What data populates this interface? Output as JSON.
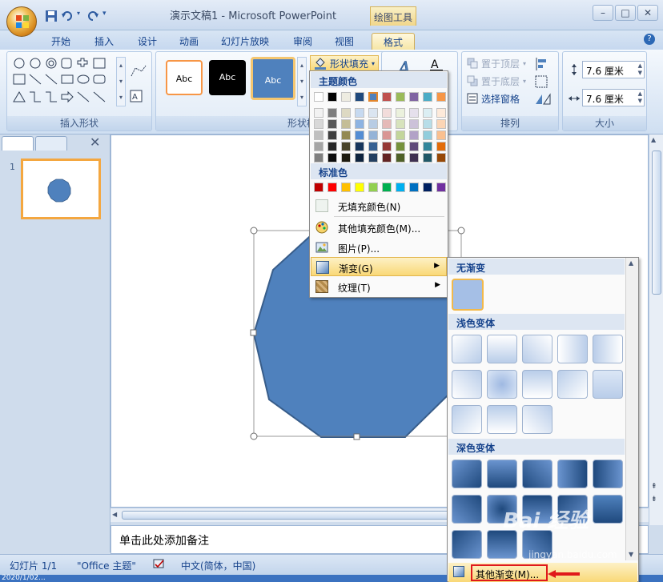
{
  "titlebar": {
    "doc_title": "演示文稿1 - Microsoft PowerPoint",
    "context_tab_title": "绘图工具",
    "minimize": "–",
    "maximize": "□",
    "close": "✕"
  },
  "tabs": [
    {
      "label": "开始"
    },
    {
      "label": "插入"
    },
    {
      "label": "设计"
    },
    {
      "label": "动画"
    },
    {
      "label": "幻灯片放映"
    },
    {
      "label": "审阅"
    },
    {
      "label": "视图"
    },
    {
      "label": "格式"
    }
  ],
  "ribbon": {
    "insert_shapes": {
      "label": "插入形状"
    },
    "shape_styles": {
      "label": "形状样式",
      "swatch_text": "Abc",
      "fill_button": "形状填充"
    },
    "arrange": {
      "label": "排列",
      "bring_front": "置于顶层",
      "send_back": "置于底层",
      "selection_pane": "选择窗格"
    },
    "size": {
      "label": "大小",
      "height": "7.6 厘米",
      "width": "7.6 厘米"
    }
  },
  "fill_menu": {
    "theme_colors_header": "主题颜色",
    "standard_colors_header": "标准色",
    "theme_top_row": [
      "#ffffff",
      "#000000",
      "#eeece1",
      "#1f497d",
      "#4f81bd",
      "#c0504d",
      "#9bbb59",
      "#8064a2",
      "#4bacc6",
      "#f79646"
    ],
    "theme_shades": [
      [
        "#f2f2f2",
        "#7f7f7f",
        "#ddd9c3",
        "#c6d9f0",
        "#dbe5f1",
        "#f2dcdb",
        "#ebf1dd",
        "#e5e0ec",
        "#dbeef3",
        "#fdeada"
      ],
      [
        "#d8d8d8",
        "#595959",
        "#c4bd97",
        "#8db3e2",
        "#b8cce4",
        "#e5b9b7",
        "#d7e3bc",
        "#ccc1d9",
        "#b7dde8",
        "#fbd5b5"
      ],
      [
        "#bfbfbf",
        "#3f3f3f",
        "#938953",
        "#548dd4",
        "#95b3d7",
        "#d99694",
        "#c3d69b",
        "#b2a2c7",
        "#92cddc",
        "#fac08f"
      ],
      [
        "#a5a5a5",
        "#262626",
        "#494429",
        "#17365d",
        "#366092",
        "#953734",
        "#76923c",
        "#5f497a",
        "#31859b",
        "#e36c09"
      ],
      [
        "#7f7f7f",
        "#0c0c0c",
        "#1d1b10",
        "#0f243e",
        "#244061",
        "#632423",
        "#4f6128",
        "#3f3151",
        "#205867",
        "#974806"
      ]
    ],
    "standard_colors": [
      "#c00000",
      "#ff0000",
      "#ffc000",
      "#ffff00",
      "#92d050",
      "#00b050",
      "#00b0f0",
      "#0070c0",
      "#002060",
      "#7030a0"
    ],
    "items": {
      "no_fill": "无填充颜色(N)",
      "more_colors": "其他填充颜色(M)...",
      "picture": "图片(P)...",
      "gradient": "渐变(G)",
      "texture": "纹理(T)"
    }
  },
  "gradient_menu": {
    "no_gradient_header": "无渐变",
    "light_header": "浅色变体",
    "dark_header": "深色变体",
    "more_gradients": "其他渐变(M)..."
  },
  "slide_pane": {
    "slide_number": "1"
  },
  "notes": {
    "placeholder": "单击此处添加备注"
  },
  "statusbar": {
    "slide_info": "幻灯片 1/1",
    "theme": "\"Office 主题\"",
    "language": "中文(简体，中国)"
  },
  "taskbar": {
    "text": "2020/1/02..."
  },
  "watermark": {
    "brand": "Bai 经验",
    "url": "jingyan.baidu.com"
  },
  "colors": {
    "shape_fill": "#4f81bd",
    "accent": "#f4a740",
    "highlight_red": "#e0191b"
  }
}
